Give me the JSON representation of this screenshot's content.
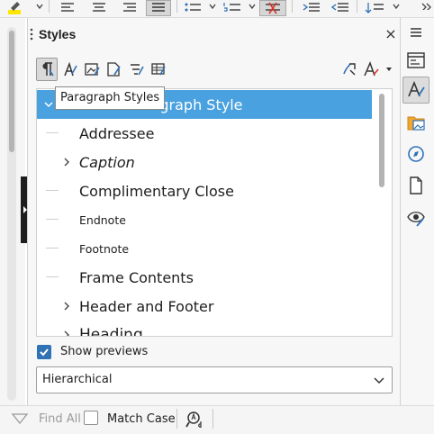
{
  "sidebar": {
    "title": "Styles",
    "close_symbol": "×",
    "style_categories": [
      {
        "name": "paragraph-styles",
        "icon": "paragraph-styles-icon",
        "active": true
      },
      {
        "name": "character-styles",
        "icon": "character-styles-icon",
        "active": false
      },
      {
        "name": "frame-styles",
        "icon": "frame-styles-icon",
        "active": false
      },
      {
        "name": "page-styles",
        "icon": "page-styles-icon",
        "active": false
      },
      {
        "name": "list-styles",
        "icon": "list-styles-icon",
        "active": false
      },
      {
        "name": "table-styles",
        "icon": "table-styles-icon",
        "active": false
      }
    ],
    "actions": [
      "fill-format-mode-icon",
      "styles-actions-icon"
    ],
    "tooltip": "Paragraph Styles",
    "tree": {
      "items": [
        {
          "label": "Paragraph Style",
          "partial_label": "ragraph Style",
          "selected": true,
          "expandable": true,
          "expanded": true,
          "level": 0
        },
        {
          "label": "Addressee",
          "selected": false,
          "expandable": false,
          "level": 1
        },
        {
          "label": "Caption",
          "selected": false,
          "expandable": true,
          "italic": true,
          "level": 1
        },
        {
          "label": "Complimentary Close",
          "selected": false,
          "expandable": false,
          "level": 1
        },
        {
          "label": "Endnote",
          "selected": false,
          "expandable": false,
          "small": true,
          "level": 1
        },
        {
          "label": "Footnote",
          "selected": false,
          "expandable": false,
          "small": true,
          "level": 1
        },
        {
          "label": "Frame Contents",
          "selected": false,
          "expandable": false,
          "level": 1
        },
        {
          "label": "Header and Footer",
          "selected": false,
          "expandable": true,
          "level": 1
        },
        {
          "label": "Heading",
          "selected": false,
          "expandable": true,
          "level": 1
        }
      ]
    },
    "show_previews": {
      "label": "Show previews",
      "checked": true
    },
    "filter_select": {
      "value": "Hierarchical"
    }
  },
  "findbar": {
    "find_all_label": "Find All",
    "match_case_label": "Match Case",
    "match_case_checked": false
  },
  "tabbar": {
    "tabs": [
      {
        "icon": "properties-icon",
        "active": false
      },
      {
        "icon": "styles-icon",
        "active": true
      },
      {
        "icon": "gallery-icon",
        "active": false
      },
      {
        "icon": "navigator-icon",
        "active": false
      },
      {
        "icon": "page-icon",
        "active": false
      },
      {
        "icon": "style-inspector-icon",
        "active": false
      }
    ]
  },
  "colors": {
    "selection": "#49a1e0",
    "checkbox": "#2f72b6",
    "cancel_red": "#d9342b",
    "highlight_yellow": "#ffe600"
  }
}
